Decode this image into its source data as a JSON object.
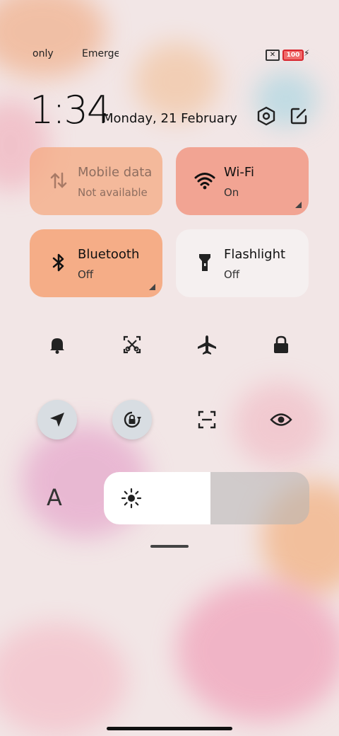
{
  "status_bar": {
    "left_text_1": "only",
    "left_text_2": "Emergency",
    "battery_level": "100",
    "sim_icon": "no-sim-icon",
    "charging_icon": "bolt-icon"
  },
  "header": {
    "time": "1:34",
    "date": "Monday, 21 February",
    "settings_icon": "settings-hex-icon",
    "edit_icon": "edit-icon"
  },
  "tiles": [
    {
      "label": "Mobile data",
      "sub": "Not available",
      "icon": "mobile-data-icon",
      "state": "disabled"
    },
    {
      "label": "Wi-Fi",
      "sub": "On",
      "icon": "wifi-icon",
      "state": "on"
    },
    {
      "label": "Bluetooth",
      "sub": "Off",
      "icon": "bluetooth-icon",
      "state": "off"
    },
    {
      "label": "Flashlight",
      "sub": "Off",
      "icon": "flashlight-icon",
      "state": "off"
    }
  ],
  "toggles_row1": [
    "bell-icon",
    "screenshot-icon",
    "airplane-icon",
    "lock-icon"
  ],
  "toggles_row2": [
    "location-icon",
    "rotation-lock-icon",
    "scan-icon",
    "eye-icon"
  ],
  "brightness": {
    "level": 0.52,
    "icon": "sun-icon"
  },
  "font_button": "A",
  "colors": {
    "accent_tile": "#f4b08e",
    "wifi_tile": "#f2a08e",
    "inactive_tile": "#f3f0f0"
  }
}
